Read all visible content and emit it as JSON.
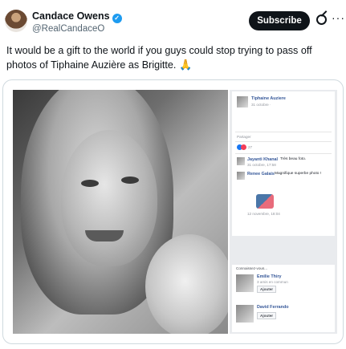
{
  "author": {
    "name": "Candace Owens",
    "handle": "@RealCandaceO",
    "verified_glyph": "✓"
  },
  "header": {
    "subscribe_label": "Subscribe",
    "more_glyph": "···"
  },
  "tweet": {
    "text": "It would be a gift to the world if you guys could stop trying to pass off photos of Tiphaine Auzière as Brigitte.",
    "emoji": "🙏"
  },
  "facebook_screenshot": {
    "poster_name": "Tiphaine Auziere",
    "post_date": "31 octobre ·",
    "share_label": "Partager",
    "reaction_count": "27",
    "comments": [
      {
        "name": "Jayanti Khanal",
        "text": "Très beau foto.",
        "meta": "31 octobre, 17:58"
      },
      {
        "name": "Renee Galais",
        "text": "Magnifique superbe photo !",
        "meta": ""
      }
    ],
    "sticker_date": "12 novembre, 18:04",
    "suggest_heading": "Connaissez-vous...",
    "suggestions": [
      {
        "name": "Emilie Thiry",
        "meta": "3 amis en commun",
        "button": "Ajouter"
      },
      {
        "name": "David Ferrando",
        "meta": "",
        "button": "Ajouter"
      }
    ]
  },
  "icons": [
    "verified-badge-icon",
    "grok-icon",
    "more-icon",
    "pray-emoji-icon"
  ],
  "colors": {
    "accent": "#1d9bf0",
    "subscribe_bg": "#0f1419",
    "fb_link": "#365899"
  }
}
